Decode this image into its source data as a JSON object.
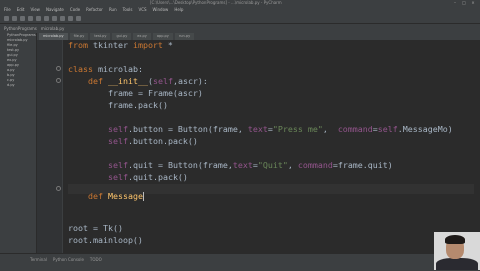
{
  "window": {
    "title": "[C:\\Users\\...\\Desktop\\PythonPrograms] - ...\\microlab.py - PyCharm",
    "controls": [
      "minimize",
      "maximize",
      "close"
    ]
  },
  "menu": [
    "File",
    "Edit",
    "View",
    "Navigate",
    "Code",
    "Refactor",
    "Run",
    "Tools",
    "VCS",
    "Window",
    "Help"
  ],
  "navbar": [
    "PythonPrograms",
    "microlab.py"
  ],
  "project_tree": [
    "PythonPrograms",
    "microlab.py",
    "file.py",
    "test.py",
    "gui.py",
    "ex.py",
    "app.py",
    "a.py",
    "b.py",
    "c.py",
    "d.py"
  ],
  "editor_tabs": [
    {
      "label": "microlab.py",
      "active": true
    },
    {
      "label": "file.py",
      "active": false
    },
    {
      "label": "test.py",
      "active": false
    },
    {
      "label": "gui.py",
      "active": false
    },
    {
      "label": "ex.py",
      "active": false
    },
    {
      "label": "app.py",
      "active": false
    },
    {
      "label": "run.py",
      "active": false
    }
  ],
  "code": {
    "l1": {
      "kw1": "from",
      "mod": " tkinter ",
      "kw2": "import",
      "rest": " *"
    },
    "l2": {
      "kw": "class",
      "name": " microlab:"
    },
    "l3": {
      "kw": "def",
      "name": " __init__",
      "open": "(",
      "self": "self",
      "rest": ",ascr):"
    },
    "l4": "frame = Frame(ascr)",
    "l5": "frame.pack()",
    "l6": {
      "self": "self",
      "mid": ".button = Button(frame, ",
      "kw": "text",
      "eq": "=",
      "str": "\"Press me\"",
      "sep": ",  ",
      "kw2": "command",
      "eq2": "=",
      "self2": "self",
      "end": ".MessageMo)"
    },
    "l7": {
      "self": "self",
      "rest": ".button.pack()"
    },
    "l8": {
      "self": "self",
      "mid": ".quit = Button(frame,",
      "kw": "text",
      "eq": "=",
      "str": "\"Quit\"",
      "sep": ", ",
      "kw2": "command",
      "end": "=frame.quit)"
    },
    "l9": {
      "self": "self",
      "rest": ".quit.pack()"
    },
    "l10": {
      "kw": "def",
      "name": " Message"
    },
    "l11": "root = Tk()",
    "l12": "root.mainloop()"
  },
  "bottom_tabs": [
    "Terminal",
    "Python Console",
    "TODO"
  ],
  "status": "",
  "colors": {
    "background": "#2b2b2b",
    "keyword": "#cc7832",
    "function": "#ffc66d",
    "string": "#6a8759",
    "self": "#94558d",
    "text": "#a9b7c6"
  }
}
